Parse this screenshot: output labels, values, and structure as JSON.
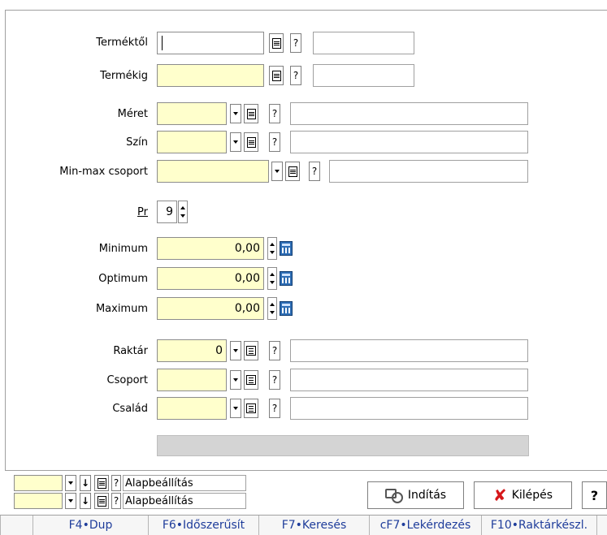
{
  "form": {
    "termektol": {
      "label": "Terméktől",
      "value": "",
      "desc": ""
    },
    "termekig": {
      "label": "Termékig",
      "value": "",
      "desc": ""
    },
    "meret": {
      "label": "Méret",
      "value": "",
      "desc": ""
    },
    "szin": {
      "label": "Szín",
      "value": "",
      "desc": ""
    },
    "minmax": {
      "label": "Min-max csoport",
      "value": "",
      "desc": ""
    },
    "pr": {
      "label": "Pr",
      "value": "9"
    },
    "minimum": {
      "label": "Minimum",
      "value": "0,00"
    },
    "optimum": {
      "label": "Optimum",
      "value": "0,00"
    },
    "maximum": {
      "label": "Maximum",
      "value": "0,00"
    },
    "raktar": {
      "label": "Raktár",
      "value": "0",
      "desc": ""
    },
    "csoport": {
      "label": "Csoport",
      "value": "",
      "desc": ""
    },
    "csalad": {
      "label": "Család",
      "value": "",
      "desc": ""
    },
    "help_glyph": "?"
  },
  "settings_rows": [
    {
      "value": "",
      "label": "Alapbeállítás"
    },
    {
      "value": "",
      "label": "Alapbeállítás"
    }
  ],
  "actions": {
    "start_label": "Indítás",
    "exit_label": "Kilépés",
    "help_label": "?"
  },
  "fkeys": [
    "F4•Dup",
    "F6•Időszerűsít",
    "F7•Keresés",
    "cF7•Lekérdezés",
    "F10•Raktárkészl."
  ],
  "colors": {
    "required_field": "#ffffcc",
    "fkey_text": "#1f3d9b",
    "exit_icon": "#d6171a"
  }
}
